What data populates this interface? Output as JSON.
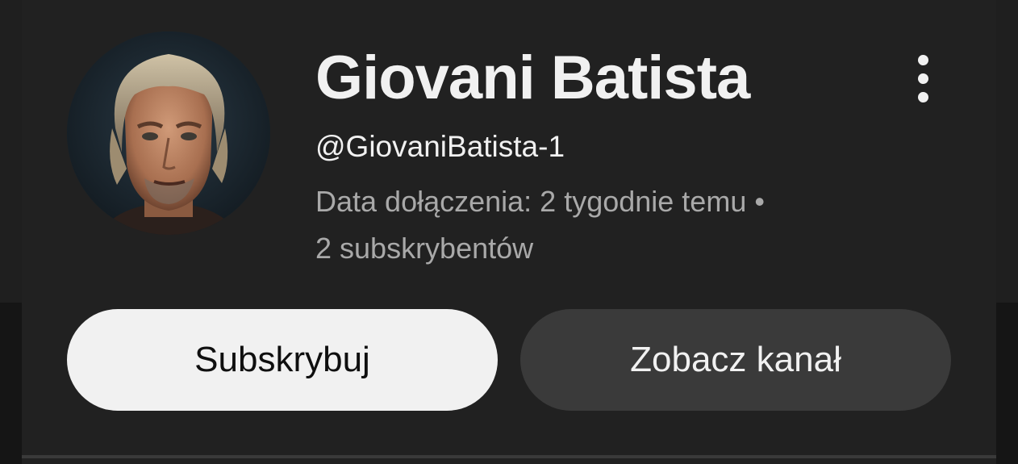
{
  "channel": {
    "name": "Giovani Batista",
    "handle": "@GiovaniBatista-1",
    "joined": "Data dołączenia: 2 tygodnie temu •",
    "subscribers": "2 subskrybentów"
  },
  "actions": {
    "subscribe_label": "Subskrybuj",
    "view_channel_label": "Zobacz kanał"
  },
  "icons": {
    "menu": "more-vert-icon"
  },
  "colors": {
    "background": "#212121",
    "primary_button": "#f1f1f1",
    "secondary_button": "#3a3a3a",
    "text_secondary": "#a9a9a9"
  }
}
